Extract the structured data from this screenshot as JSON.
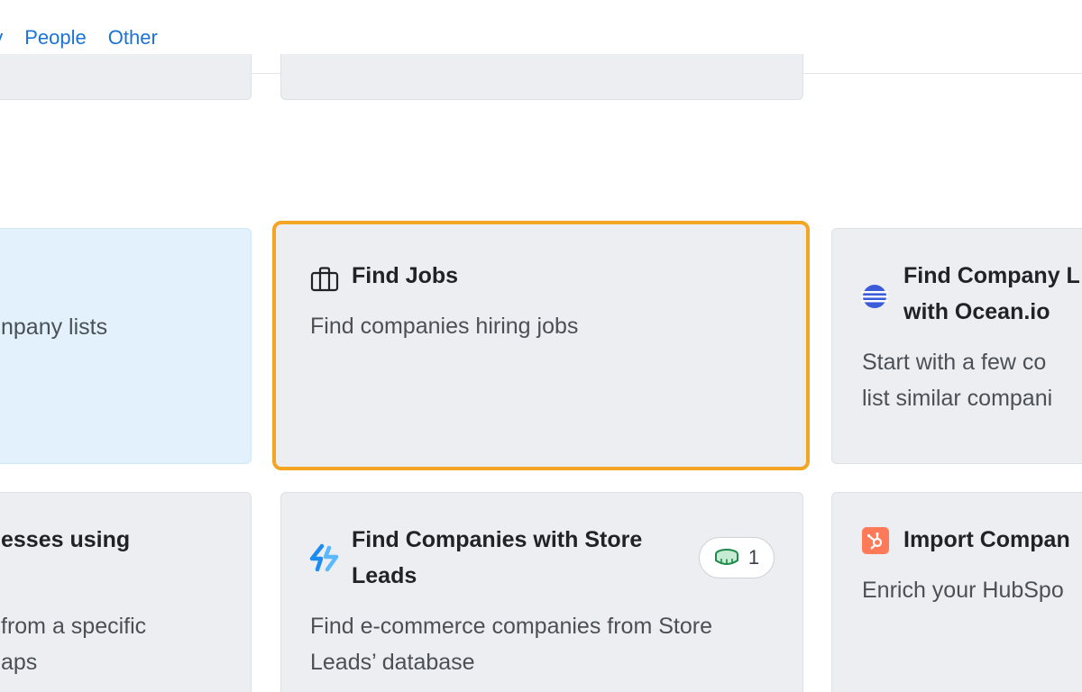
{
  "tabs": [
    {
      "label": "ny"
    },
    {
      "label": "People"
    },
    {
      "label": "Other"
    }
  ],
  "cards": {
    "company_lists": {
      "desc": "npany lists"
    },
    "find_jobs": {
      "title": "Find Jobs",
      "desc": "Find companies hiring jobs"
    },
    "ocean": {
      "title_line1": "Find Company L",
      "title_line2": "with Ocean.io",
      "desc_line1": "Start with a few co",
      "desc_line2": "list similar compani"
    },
    "businesses": {
      "title": "esses using",
      "desc_line1": "from a specific",
      "desc_line2": "aps"
    },
    "store_leads": {
      "title_line1": "Find Companies with Store",
      "title_line2": "Leads",
      "desc_line1": "Find e-commerce companies from Store",
      "desc_line2": "Leads’ database",
      "badge_count": "1"
    },
    "hubspot": {
      "title": "Import Compan",
      "desc": "Enrich your HubSpo"
    }
  },
  "icons": {
    "find_jobs": "briefcase-icon",
    "ocean": "ocean-io-logo-icon",
    "store_leads": "store-leads-logo-icon",
    "credits": "coin-stack-icon",
    "hubspot": "hubspot-logo-icon"
  },
  "colors": {
    "tab_link": "#1a73d6",
    "selected_border": "#f5a524",
    "card_bg": "#eceef1",
    "highlight_card_bg": "#e2f1fb",
    "ocean_blue": "#3b5bdb",
    "hubspot_orange": "#ff7a59",
    "credit_green": "#1f8a4c"
  }
}
